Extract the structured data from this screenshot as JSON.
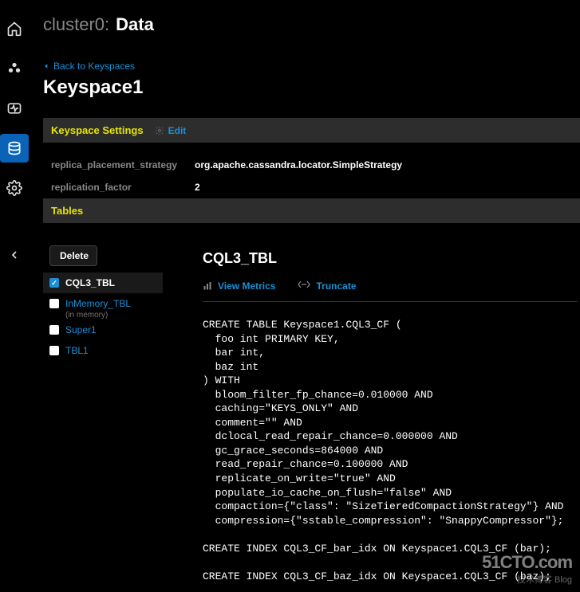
{
  "header": {
    "cluster_muted": "cluster0:",
    "cluster_bold": "Data"
  },
  "breadcrumb": {
    "text": "Back to Keyspaces"
  },
  "keyspace": {
    "name": "Keyspace1"
  },
  "sections": {
    "settings_title": "Keyspace Settings",
    "tables_title": "Tables",
    "edit_label": "Edit"
  },
  "settings": {
    "replica_placement_strategy_key": "replica_placement_strategy",
    "replica_placement_strategy_val": "org.apache.cassandra.locator.SimpleStrategy",
    "replication_factor_key": "replication_factor",
    "replication_factor_val": "2"
  },
  "tables": {
    "delete_label": "Delete",
    "items": [
      {
        "label": "CQL3_TBL",
        "selected": true,
        "checked": true
      },
      {
        "label": "InMemory_TBL",
        "selected": false,
        "checked": false,
        "sublabel": "(in memory)"
      },
      {
        "label": "Super1",
        "selected": false,
        "checked": false
      },
      {
        "label": "TBL1",
        "selected": false,
        "checked": false
      }
    ]
  },
  "detail": {
    "title": "CQL3_TBL",
    "view_metrics_label": "View Metrics",
    "truncate_label": "Truncate",
    "cql": "CREATE TABLE Keyspace1.CQL3_CF (\n  foo int PRIMARY KEY,\n  bar int,\n  baz int\n) WITH\n  bloom_filter_fp_chance=0.010000 AND\n  caching=\"KEYS_ONLY\" AND\n  comment=\"\" AND\n  dclocal_read_repair_chance=0.000000 AND\n  gc_grace_seconds=864000 AND\n  read_repair_chance=0.100000 AND\n  replicate_on_write=\"true\" AND\n  populate_io_cache_on_flush=\"false\" AND\n  compaction={\"class\": \"SizeTieredCompactionStrategy\"} AND\n  compression={\"sstable_compression\": \"SnappyCompressor\"};\n\nCREATE INDEX CQL3_CF_bar_idx ON Keyspace1.CQL3_CF (bar);\n\nCREATE INDEX CQL3_CF_baz_idx ON Keyspace1.CQL3_CF (baz);"
  },
  "watermark": {
    "main": "51CTO.com",
    "sub": "技术博客  Blog"
  }
}
